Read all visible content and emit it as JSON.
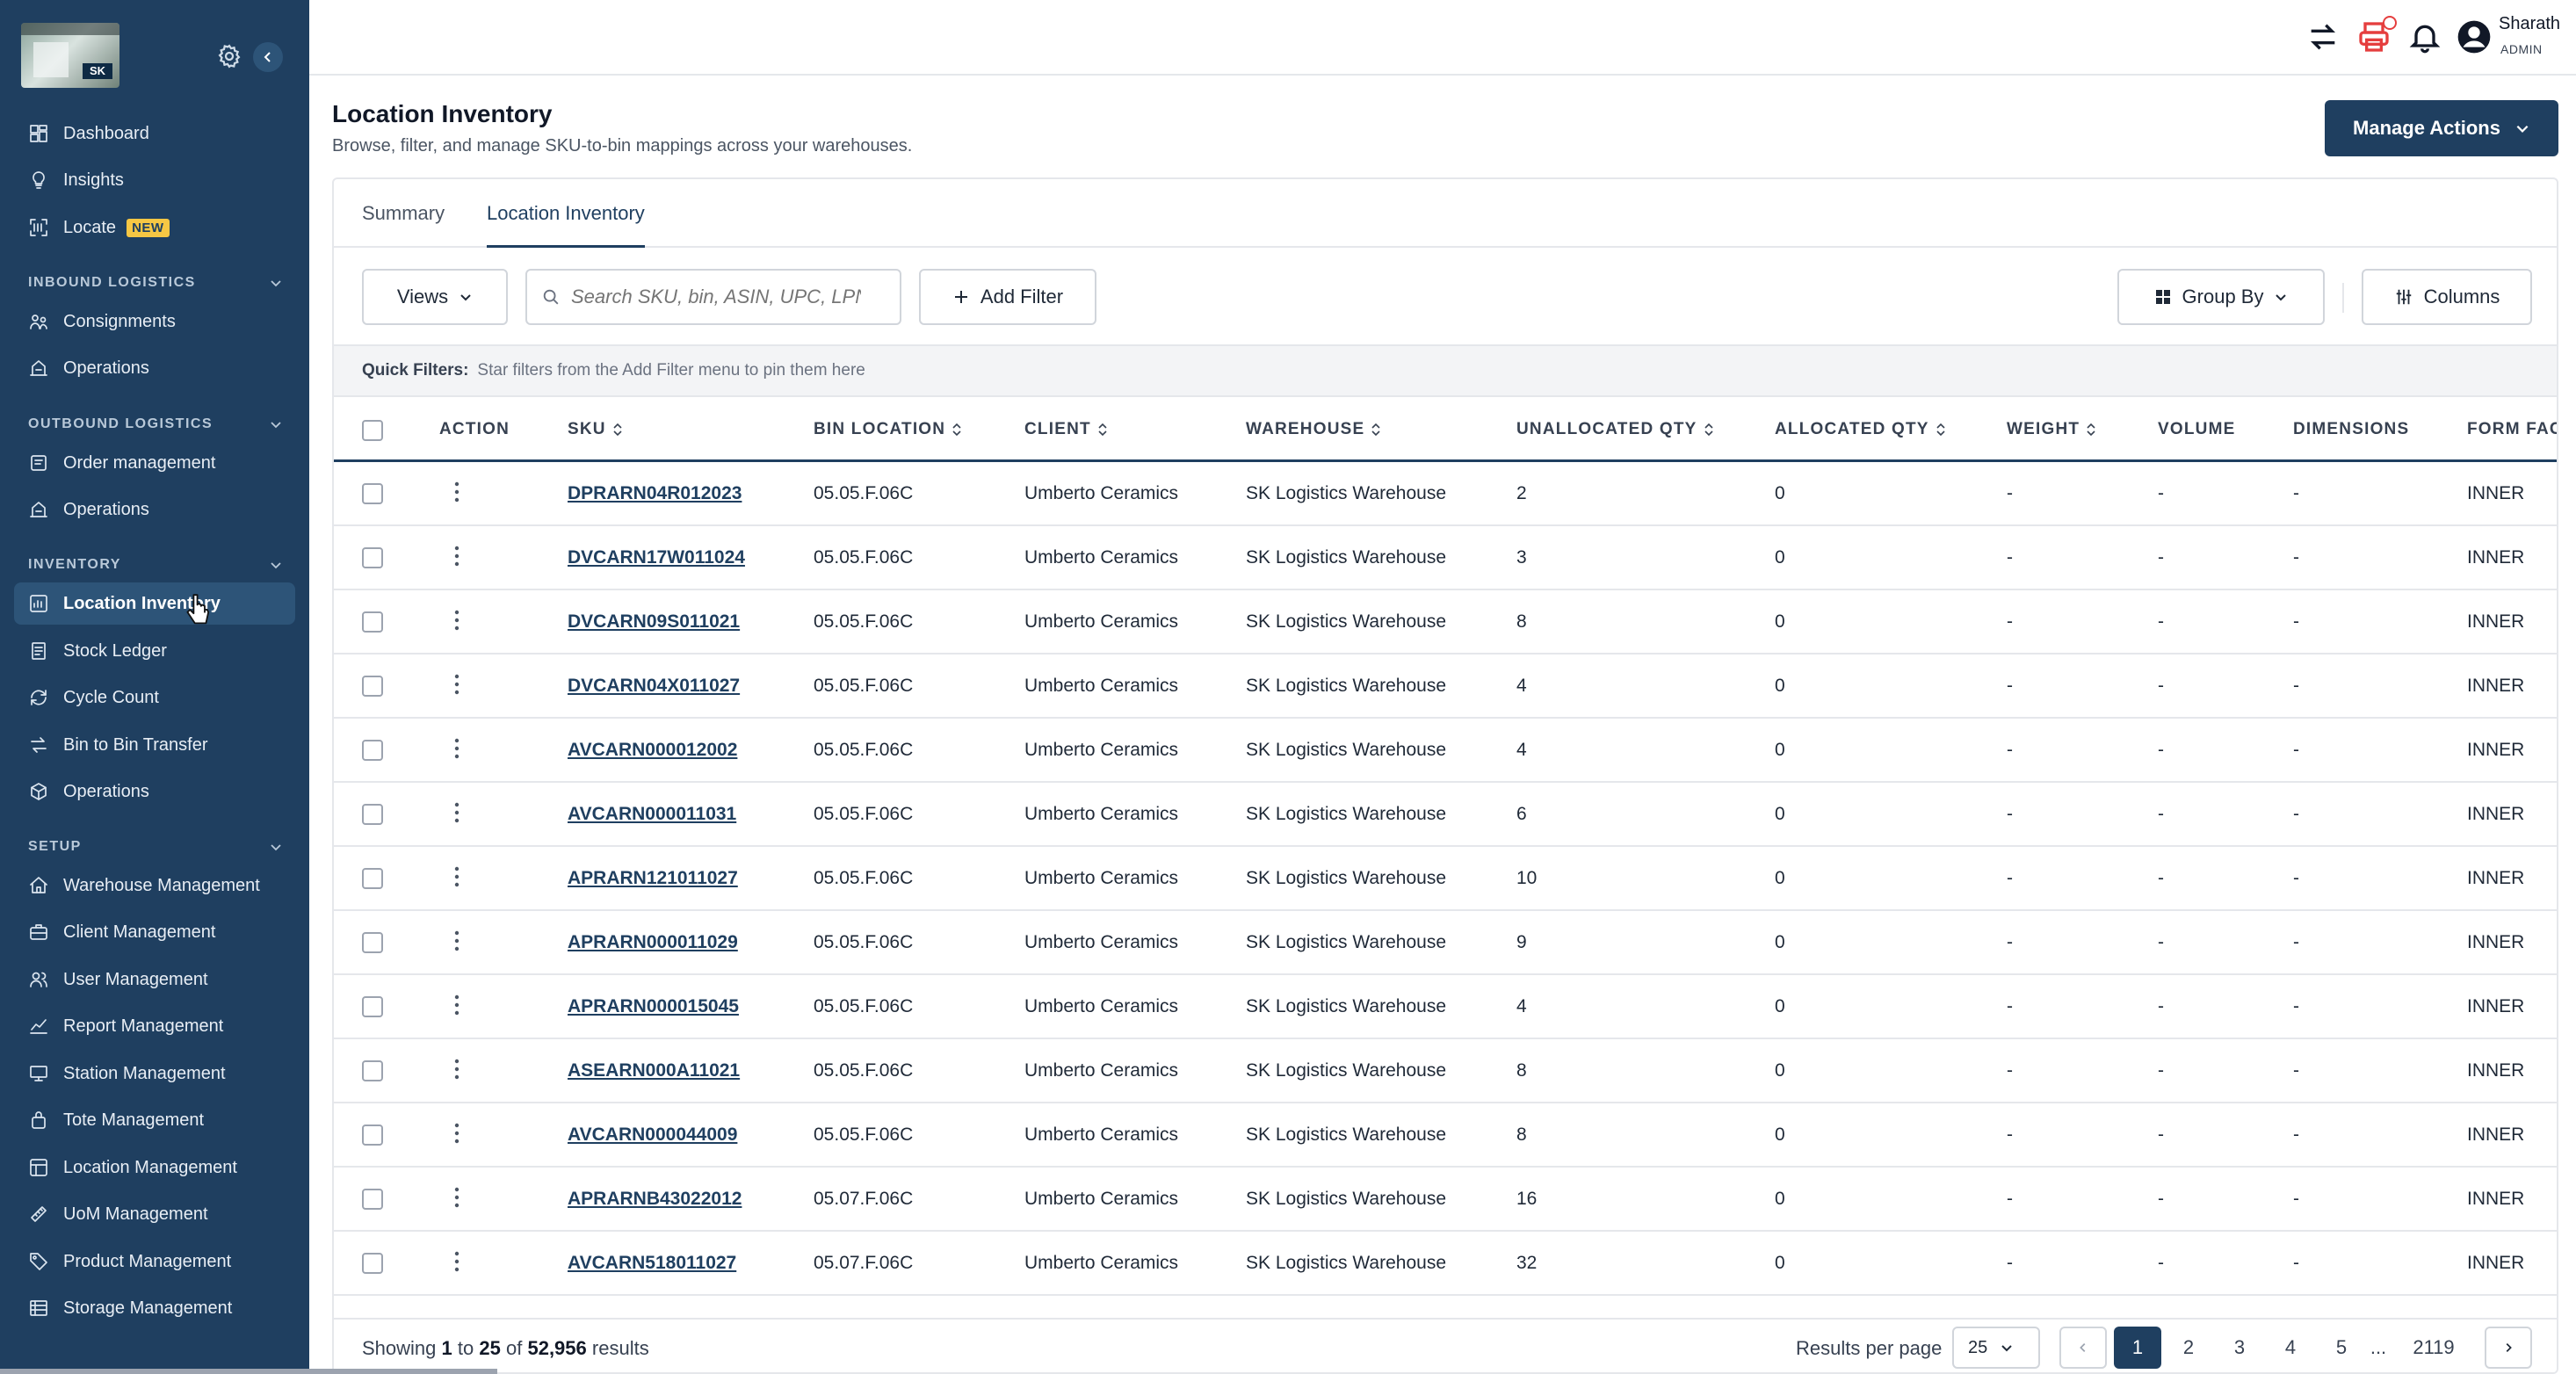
{
  "colors": {
    "sidebar": "#1f3f60",
    "accent": "#1f3f60",
    "active_nav": "#2d5478",
    "badge_new": "#f6c744",
    "notif": "#e53e3e"
  },
  "sidebar": {
    "logo_text": "SK",
    "top_items": [
      {
        "label": "Dashboard",
        "icon": "dashboard-icon"
      },
      {
        "label": "Insights",
        "icon": "lightbulb-icon"
      },
      {
        "label": "Locate",
        "icon": "scan-icon",
        "badge": "NEW"
      }
    ],
    "sections": [
      {
        "title": "INBOUND LOGISTICS",
        "items": [
          {
            "label": "Consignments",
            "icon": "truck-icon"
          },
          {
            "label": "Operations",
            "icon": "operations-icon"
          }
        ]
      },
      {
        "title": "OUTBOUND LOGISTICS",
        "items": [
          {
            "label": "Order management",
            "icon": "order-icon"
          },
          {
            "label": "Operations",
            "icon": "operations-icon"
          }
        ]
      },
      {
        "title": "INVENTORY",
        "items": [
          {
            "label": "Location Inventory",
            "icon": "chart-icon",
            "active": true
          },
          {
            "label": "Stock Ledger",
            "icon": "ledger-icon"
          },
          {
            "label": "Cycle Count",
            "icon": "refresh-icon"
          },
          {
            "label": "Bin to Bin Transfer",
            "icon": "transfer-icon"
          },
          {
            "label": "Operations",
            "icon": "box-icon"
          }
        ]
      },
      {
        "title": "SETUP",
        "items": [
          {
            "label": "Warehouse Management",
            "icon": "home-icon"
          },
          {
            "label": "Client Management",
            "icon": "briefcase-icon"
          },
          {
            "label": "User Management",
            "icon": "users-icon"
          },
          {
            "label": "Report Management",
            "icon": "report-icon"
          },
          {
            "label": "Station Management",
            "icon": "monitor-icon"
          },
          {
            "label": "Tote Management",
            "icon": "tote-icon"
          },
          {
            "label": "Location Management",
            "icon": "location-icon"
          },
          {
            "label": "UoM Management",
            "icon": "ruler-icon"
          },
          {
            "label": "Product Management",
            "icon": "tag-icon"
          },
          {
            "label": "Storage Management",
            "icon": "storage-icon"
          }
        ]
      }
    ]
  },
  "header": {
    "user_name": "Sharath",
    "user_role": "ADMIN"
  },
  "page": {
    "title": "Location Inventory",
    "subtitle": "Browse, filter, and manage SKU-to-bin mappings across your warehouses.",
    "manage_actions": "Manage Actions"
  },
  "tabs": [
    {
      "label": "Summary"
    },
    {
      "label": "Location Inventory",
      "active": true
    }
  ],
  "toolbar": {
    "views": "Views",
    "search_placeholder": "Search SKU, bin, ASIN, UPC, LPN",
    "add_filter": "Add Filter",
    "group_by": "Group By",
    "columns": "Columns"
  },
  "quick_filters": {
    "label": "Quick Filters:",
    "hint": "Star filters from the Add Filter menu to pin them here"
  },
  "table": {
    "headers": {
      "action": "ACTION",
      "sku": "SKU",
      "bin": "BIN LOCATION",
      "client": "CLIENT",
      "warehouse": "WAREHOUSE",
      "unalloc": "UNALLOCATED QTY",
      "alloc": "ALLOCATED QTY",
      "weight": "WEIGHT",
      "volume": "VOLUME",
      "dimensions": "DIMENSIONS",
      "form": "FORM FACTOR"
    },
    "rows": [
      {
        "sku": "DPRARN04R012023",
        "bin": "05.05.F.06C",
        "client": "Umberto Ceramics",
        "warehouse": "SK Logistics Warehouse",
        "unalloc": "2",
        "alloc": "0",
        "weight": "-",
        "volume": "-",
        "dimensions": "-",
        "form": "INNER"
      },
      {
        "sku": "DVCARN17W011024",
        "bin": "05.05.F.06C",
        "client": "Umberto Ceramics",
        "warehouse": "SK Logistics Warehouse",
        "unalloc": "3",
        "alloc": "0",
        "weight": "-",
        "volume": "-",
        "dimensions": "-",
        "form": "INNER"
      },
      {
        "sku": "DVCARN09S011021",
        "bin": "05.05.F.06C",
        "client": "Umberto Ceramics",
        "warehouse": "SK Logistics Warehouse",
        "unalloc": "8",
        "alloc": "0",
        "weight": "-",
        "volume": "-",
        "dimensions": "-",
        "form": "INNER"
      },
      {
        "sku": "DVCARN04X011027",
        "bin": "05.05.F.06C",
        "client": "Umberto Ceramics",
        "warehouse": "SK Logistics Warehouse",
        "unalloc": "4",
        "alloc": "0",
        "weight": "-",
        "volume": "-",
        "dimensions": "-",
        "form": "INNER"
      },
      {
        "sku": "AVCARN000012002",
        "bin": "05.05.F.06C",
        "client": "Umberto Ceramics",
        "warehouse": "SK Logistics Warehouse",
        "unalloc": "4",
        "alloc": "0",
        "weight": "-",
        "volume": "-",
        "dimensions": "-",
        "form": "INNER"
      },
      {
        "sku": "AVCARN000011031",
        "bin": "05.05.F.06C",
        "client": "Umberto Ceramics",
        "warehouse": "SK Logistics Warehouse",
        "unalloc": "6",
        "alloc": "0",
        "weight": "-",
        "volume": "-",
        "dimensions": "-",
        "form": "INNER"
      },
      {
        "sku": "APRARN121011027",
        "bin": "05.05.F.06C",
        "client": "Umberto Ceramics",
        "warehouse": "SK Logistics Warehouse",
        "unalloc": "10",
        "alloc": "0",
        "weight": "-",
        "volume": "-",
        "dimensions": "-",
        "form": "INNER"
      },
      {
        "sku": "APRARN000011029",
        "bin": "05.05.F.06C",
        "client": "Umberto Ceramics",
        "warehouse": "SK Logistics Warehouse",
        "unalloc": "9",
        "alloc": "0",
        "weight": "-",
        "volume": "-",
        "dimensions": "-",
        "form": "INNER"
      },
      {
        "sku": "APRARN000015045",
        "bin": "05.05.F.06C",
        "client": "Umberto Ceramics",
        "warehouse": "SK Logistics Warehouse",
        "unalloc": "4",
        "alloc": "0",
        "weight": "-",
        "volume": "-",
        "dimensions": "-",
        "form": "INNER"
      },
      {
        "sku": "ASEARN000A11021",
        "bin": "05.05.F.06C",
        "client": "Umberto Ceramics",
        "warehouse": "SK Logistics Warehouse",
        "unalloc": "8",
        "alloc": "0",
        "weight": "-",
        "volume": "-",
        "dimensions": "-",
        "form": "INNER"
      },
      {
        "sku": "AVCARN000044009",
        "bin": "05.05.F.06C",
        "client": "Umberto Ceramics",
        "warehouse": "SK Logistics Warehouse",
        "unalloc": "8",
        "alloc": "0",
        "weight": "-",
        "volume": "-",
        "dimensions": "-",
        "form": "INNER"
      },
      {
        "sku": "APRARNB43022012",
        "bin": "05.07.F.06C",
        "client": "Umberto Ceramics",
        "warehouse": "SK Logistics Warehouse",
        "unalloc": "16",
        "alloc": "0",
        "weight": "-",
        "volume": "-",
        "dimensions": "-",
        "form": "INNER"
      },
      {
        "sku": "AVCARN518011027",
        "bin": "05.07.F.06C",
        "client": "Umberto Ceramics",
        "warehouse": "SK Logistics Warehouse",
        "unalloc": "32",
        "alloc": "0",
        "weight": "-",
        "volume": "-",
        "dimensions": "-",
        "form": "INNER"
      }
    ]
  },
  "footer": {
    "showing_pre": "Showing",
    "from": "1",
    "to_word": "to",
    "to": "25",
    "of_word": "of",
    "total": "52,956",
    "results_word": "results",
    "results_per_page_label": "Results per page",
    "per_page": "25",
    "pages": [
      "1",
      "2",
      "3",
      "4",
      "5"
    ],
    "ellipsis": "...",
    "last_page": "2119",
    "current_page": "1"
  }
}
